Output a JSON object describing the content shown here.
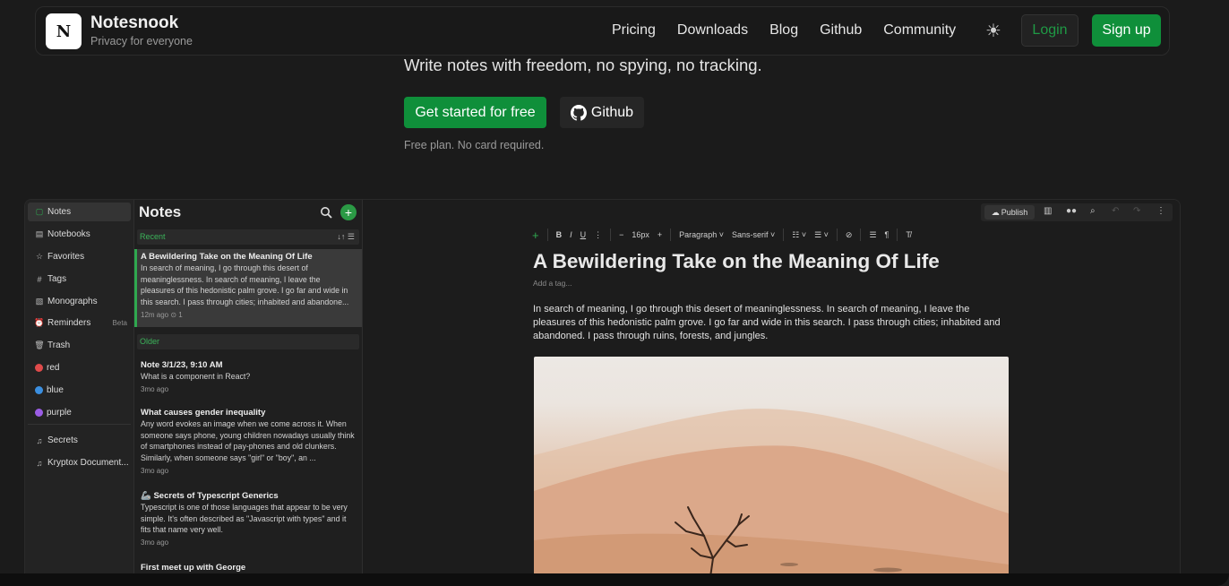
{
  "header": {
    "brand_name": "Notesnook",
    "brand_tagline": "Privacy for everyone",
    "logo_letter": "N",
    "nav": [
      "Pricing",
      "Downloads",
      "Blog",
      "Github",
      "Community"
    ],
    "login_label": "Login",
    "signup_label": "Sign up"
  },
  "hero": {
    "subtitle": "Write notes with freedom, no spying, no tracking.",
    "cta_primary": "Get started for free",
    "cta_github": "Github",
    "free_note": "Free plan. No card required."
  },
  "app": {
    "sidebar": {
      "items": [
        {
          "label": "Notes",
          "icon": "notes-icon"
        },
        {
          "label": "Notebooks",
          "icon": "notebook-icon"
        },
        {
          "label": "Favorites",
          "icon": "star-icon"
        },
        {
          "label": "Tags",
          "icon": "hash-icon"
        },
        {
          "label": "Monographs",
          "icon": "monograph-icon"
        },
        {
          "label": "Reminders",
          "icon": "alarm-icon",
          "badge": "Beta"
        },
        {
          "label": "Trash",
          "icon": "trash-icon"
        }
      ],
      "colors": [
        {
          "label": "red",
          "color": "#e04b4b"
        },
        {
          "label": "blue",
          "color": "#3b8fe0"
        },
        {
          "label": "purple",
          "color": "#9b5de5"
        }
      ],
      "shortcuts": [
        {
          "label": "Secrets",
          "icon": "shortcut-icon"
        },
        {
          "label": "Kryptox Document...",
          "icon": "shortcut-icon"
        }
      ]
    },
    "list": {
      "title": "Notes",
      "recent_label": "Recent",
      "older_label": "Older",
      "notes": [
        {
          "title": "A Bewildering Take on the Meaning Of Life",
          "body": "In search of meaning, I go through this desert of meaninglessness. In search of meaning, I leave the pleasures of this hedonistic palm grove. I go far and wide in this search. I pass through cities; inhabited and abandone...",
          "meta": "12m ago  ⊙ 1"
        },
        {
          "title": "Note 3/1/23, 9:10 AM",
          "body": "What is a component in React?",
          "meta": "3mo ago"
        },
        {
          "title": "What causes gender inequality",
          "body": "Any word evokes an image when we come across it. When someone says phone, young children nowadays usually think of smartphones instead of pay-phones and old clunkers. Similarly, when someone says \"girl\" or \"boy\", an ...",
          "meta": "3mo ago"
        },
        {
          "title": "🦾 Secrets of Typescript Generics",
          "body": "Typescript is one of those languages that appear to be very simple. It's often described as \"Javascript with types\" and it fits that name very well.",
          "meta": "3mo ago"
        },
        {
          "title": "First meet up with George",
          "body": "",
          "meta": ""
        }
      ]
    },
    "editor": {
      "publish_label": "Publish",
      "toolbar": {
        "font_size": "16px",
        "block_type": "Paragraph",
        "font_family": "Sans-serif"
      },
      "title": "A Bewildering Take on the Meaning Of Life",
      "tag_placeholder": "Add a tag...",
      "body": "In search of meaning, I go through this desert of meaninglessness. In search of meaning, I leave the pleasures of this hedonistic palm grove. I go far and wide in this search. I pass through cities; inhabited and abandoned. I pass through ruins, forests, and jungles."
    }
  }
}
